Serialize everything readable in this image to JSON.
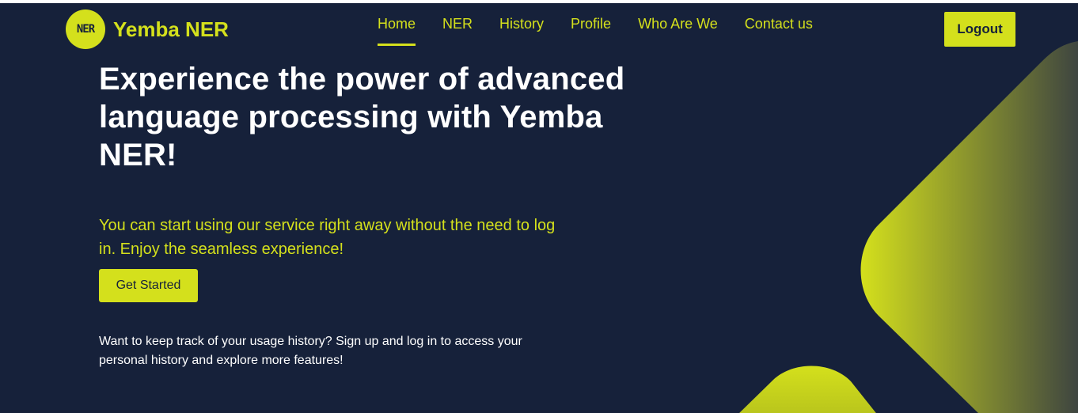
{
  "brand": {
    "logo_text": "NER",
    "name": "Yemba NER"
  },
  "nav": {
    "items": [
      {
        "label": "Home",
        "active": true
      },
      {
        "label": "NER",
        "active": false
      },
      {
        "label": "History",
        "active": false
      },
      {
        "label": "Profile",
        "active": false
      },
      {
        "label": "Who Are We",
        "active": false
      },
      {
        "label": "Contact us",
        "active": false
      }
    ],
    "logout_label": "Logout"
  },
  "hero": {
    "title": "Experience the power of advanced language processing with Yemba NER!",
    "subtitle": "You can start using our service right away without the need to log in. Enjoy the seamless experience!",
    "cta_label": "Get Started",
    "note": "Want to keep track of your usage history? Sign up and log in to access your personal history and explore more features!"
  },
  "colors": {
    "background": "#16213a",
    "accent": "#d4e01c",
    "text": "#ffffff"
  }
}
